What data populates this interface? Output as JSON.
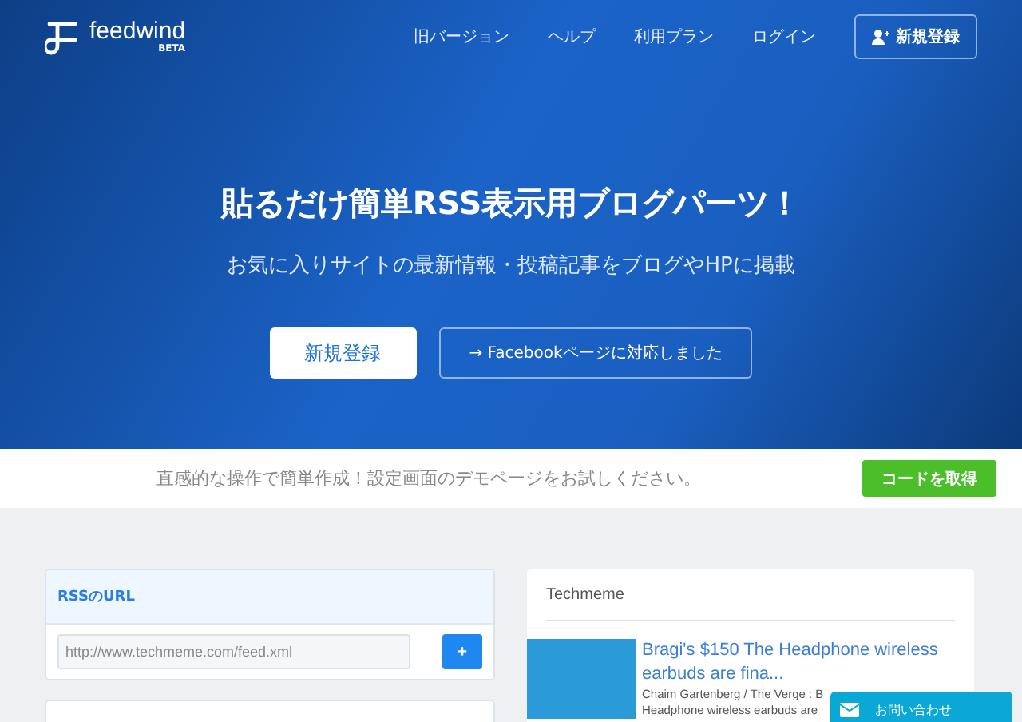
{
  "header": {
    "logo": "feedwind",
    "logo_badge": "BETA",
    "nav": [
      "旧バージョン",
      "ヘルプ",
      "利用プラン",
      "ログイン"
    ],
    "signup_button": "新規登録"
  },
  "hero": {
    "title": "貼るだけ簡単RSS表示用ブログパーツ！",
    "subtitle": "お気に入りサイトの最新情報・投稿記事をブログやHPに掲載",
    "primary_button": "新規登録",
    "secondary_button": "→ Facebookページに対応しました"
  },
  "demo_bar": {
    "text": "直感的な操作で簡単作成！設定画面のデモページをお試しください。",
    "button": "コードを取得"
  },
  "rss_card": {
    "title": "RSSのURL",
    "url_value": "http://www.techmeme.com/feed.xml",
    "add_button": "+"
  },
  "preview": {
    "title": "Techmeme",
    "item": {
      "title": "Bragi's $150 The Headphone wireless earbuds are fina...",
      "meta": "Chaim Gartenberg / The Verge : B",
      "excerpt": "Headphone wireless earbuds are"
    }
  },
  "contact_widget": {
    "label": "お問い合わせ"
  }
}
